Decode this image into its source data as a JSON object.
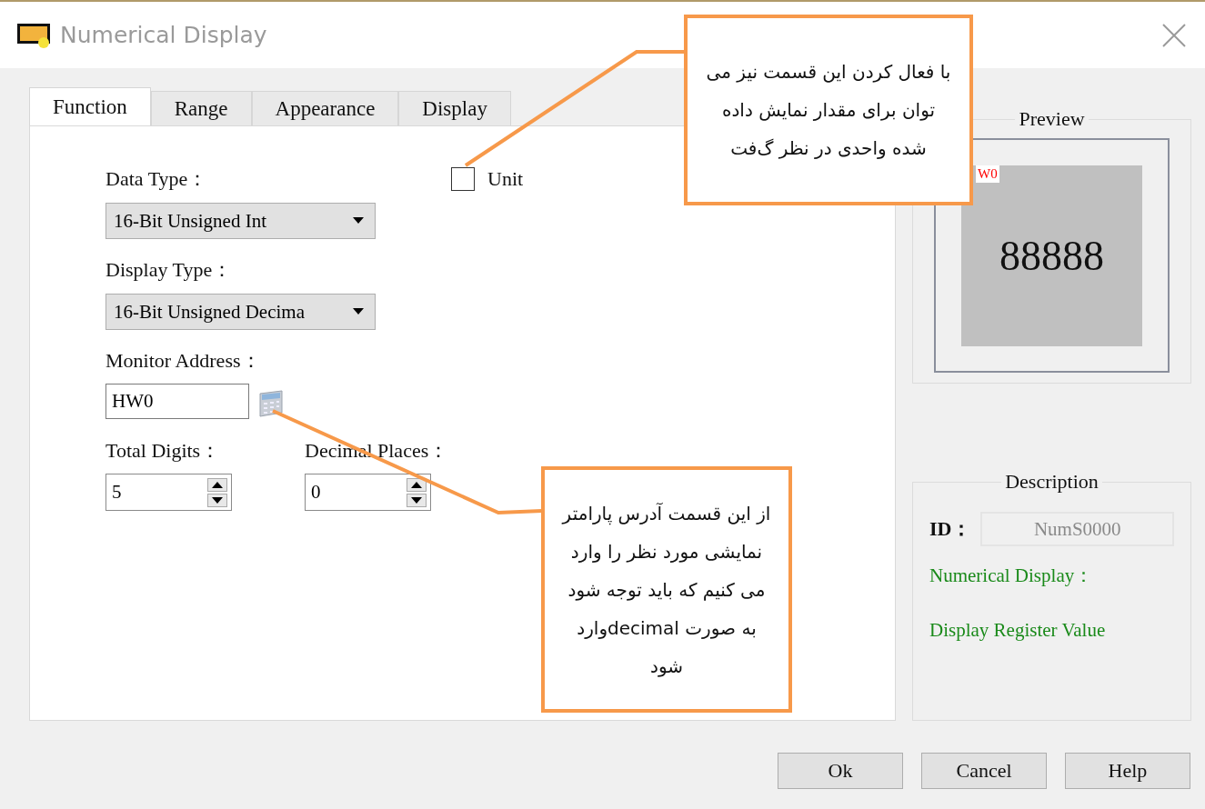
{
  "window": {
    "title": "Numerical Display"
  },
  "tabs": [
    {
      "label": "Function",
      "selected": true
    },
    {
      "label": "Range",
      "selected": false
    },
    {
      "label": "Appearance",
      "selected": false
    },
    {
      "label": "Display",
      "selected": false
    }
  ],
  "form": {
    "data_type": {
      "label": "Data Type：",
      "value": "16-Bit Unsigned Int"
    },
    "unit": {
      "label": "Unit",
      "checked": false
    },
    "display_type": {
      "label": "Display Type：",
      "value": "16-Bit Unsigned Decima"
    },
    "monitor_address": {
      "label": "Monitor Address：",
      "value": "HW0"
    },
    "total_digits": {
      "label": "Total Digits：",
      "value": "5"
    },
    "decimal_places": {
      "label": "Decimal Places：",
      "value": "0"
    }
  },
  "preview": {
    "title": "Preview",
    "address": "W0",
    "value": "88888"
  },
  "description": {
    "title": "Description",
    "id_label": "ID：",
    "id_value": "NumS0000",
    "name": "Numerical Display：",
    "text": "Display Register Value"
  },
  "buttons": [
    "Ok",
    "Cancel",
    "Help"
  ],
  "annotations": [
    {
      "text": "با فعال کردن این قسمت نیز می توان برای مقدار نمایش داده شده واحدی در نظر گ‌فت"
    },
    {
      "text": "از این قسمت آدرس پارامتر نمایشی مورد نظر را وارد می کنیم که باید توجه شود به صورت decimalوارد شود"
    }
  ]
}
